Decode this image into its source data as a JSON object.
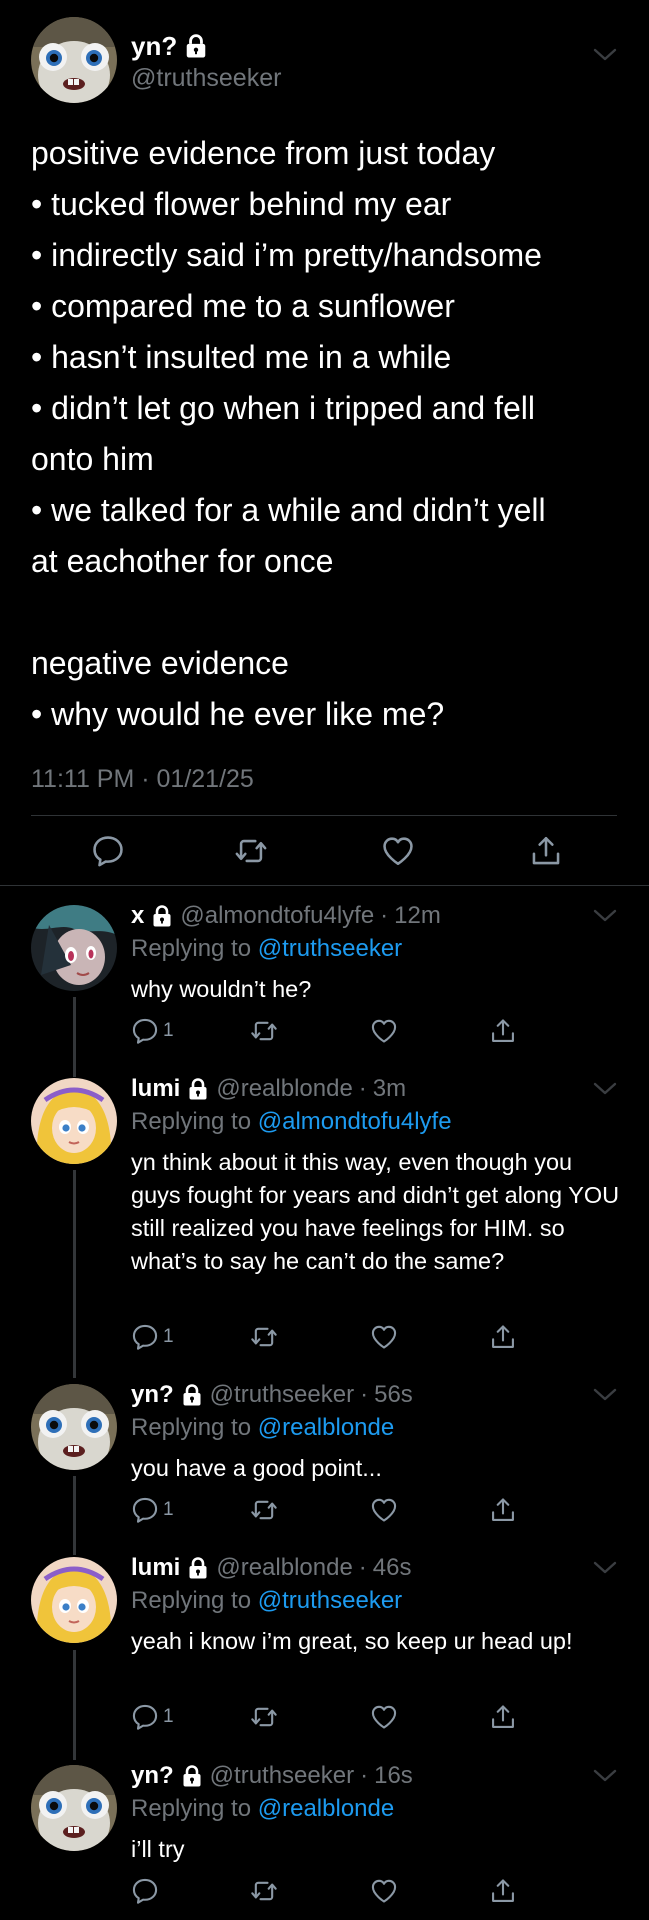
{
  "colors": {
    "background": "#000000",
    "text": "#e7e9ea",
    "muted": "#71767b",
    "link": "#1d9bf0",
    "divider": "#2f3336"
  },
  "tweet": {
    "display_name": "yn?",
    "handle": "@truthseeker",
    "lock_icon": "lock-icon",
    "lines": [
      "positive evidence from just today",
      "• tucked flower behind my ear",
      "• indirectly said i’m pretty/handsome",
      "• compared me to a sunflower",
      "• hasn’t insulted me in a while",
      "• didn’t let go when i tripped and fell",
      "onto him",
      "• we talked for a while and didn’t yell",
      "at eachother for once",
      "",
      "negative evidence",
      "• why would he ever like me?"
    ],
    "timestamp": "11:11 PM · 01/21/25",
    "actions": [
      "reply-icon",
      "retweet-icon",
      "like-icon",
      "share-icon"
    ]
  },
  "replies": [
    {
      "display_name": "x",
      "handle": "@almondtofu4lyfe",
      "time": "12m",
      "replying_label": "Replying to",
      "replying_to": "@truthseeker",
      "text": "why wouldn’t he?",
      "reply_count": "1"
    },
    {
      "display_name": "lumi",
      "handle": "@realblonde",
      "time": "3m",
      "replying_label": "Replying to",
      "replying_to": "@almondtofu4lyfe",
      "text": "yn think about it this way, even though you guys fought for years and didn’t get along YOU still realized you have feelings for HIM. so what’s to say he can’t do the same?",
      "reply_count": "1"
    },
    {
      "display_name": "yn?",
      "handle": "@truthseeker",
      "time": "56s",
      "replying_label": "Replying to",
      "replying_to": "@realblonde",
      "text": "you have a good point...",
      "reply_count": "1"
    },
    {
      "display_name": "lumi",
      "handle": "@realblonde",
      "time": "46s",
      "replying_label": "Replying to",
      "replying_to": "@truthseeker",
      "text": "yeah i know i’m great, so keep ur head up!",
      "reply_count": "1"
    },
    {
      "display_name": "yn?",
      "handle": "@truthseeker",
      "time": "16s",
      "replying_label": "Replying to",
      "replying_to": "@realblonde",
      "text": "i’ll try",
      "reply_count": ""
    }
  ],
  "separator": "·"
}
